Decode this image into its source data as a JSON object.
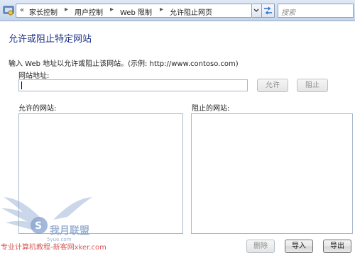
{
  "breadcrumb": {
    "chevrons": "«",
    "items": [
      "家长控制",
      "用户控制",
      "Web 限制",
      "允许阻止网页"
    ],
    "separator": "▸"
  },
  "search": {
    "placeholder": "搜索"
  },
  "page": {
    "title": "允许或阻止特定网站",
    "instruction": "输入 Web 地址以允许或阻止该网站。(示例: http://www.contoso.com)",
    "website_label": "网站地址:",
    "website_value": "",
    "allow_label": "允许",
    "block_label": "阻止",
    "allowed_label": "允许的网站:",
    "blocked_label": "阻止的网站:",
    "allowed_sites": [],
    "blocked_sites": [],
    "remove_label": "删除",
    "import_label": "导入",
    "export_label": "导出"
  },
  "watermark": {
    "logo_text": "S 我月联盟",
    "logo_subtext": "5yue.com",
    "caption": "专业计算机教程-新客网xker.com"
  },
  "colors": {
    "title": "#1e3287",
    "navbar": "#c4d5eb",
    "watermark": "#d23c3c"
  }
}
